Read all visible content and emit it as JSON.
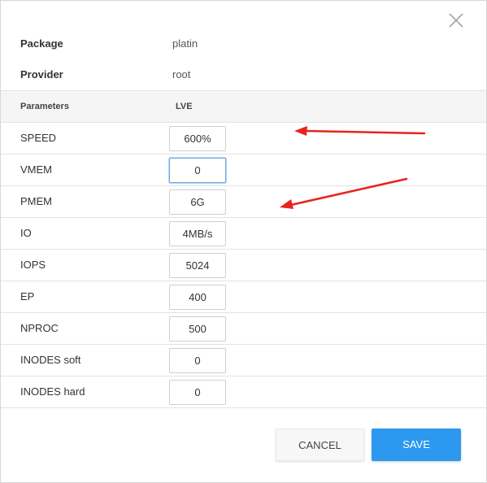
{
  "info": {
    "package_label": "Package",
    "package_value": "platin",
    "provider_label": "Provider",
    "provider_value": "root"
  },
  "params_header": {
    "label": "Parameters",
    "column": "LVE"
  },
  "params": [
    {
      "label": "SPEED",
      "value": "600%"
    },
    {
      "label": "VMEM",
      "value": "0"
    },
    {
      "label": "PMEM",
      "value": "6G"
    },
    {
      "label": "IO",
      "value": "4MB/s"
    },
    {
      "label": "IOPS",
      "value": "5024"
    },
    {
      "label": "EP",
      "value": "400"
    },
    {
      "label": "NPROC",
      "value": "500"
    },
    {
      "label": "INODES soft",
      "value": "0"
    },
    {
      "label": "INODES hard",
      "value": "0"
    }
  ],
  "buttons": {
    "cancel": "CANCEL",
    "save": "SAVE"
  },
  "colors": {
    "accent": "#2c98f0",
    "annotation_arrow": "#e8231e"
  },
  "icons": {
    "close": "close-icon"
  }
}
